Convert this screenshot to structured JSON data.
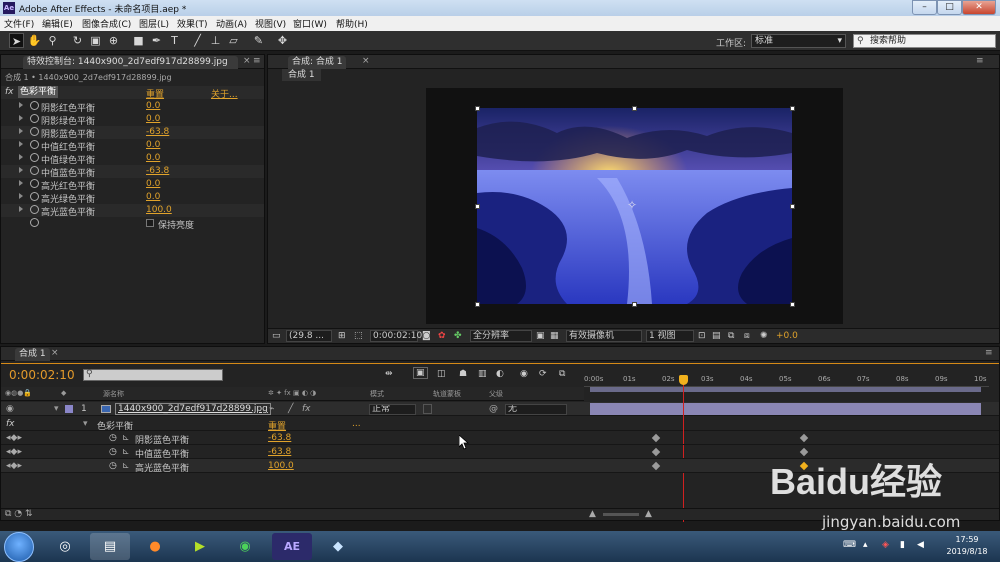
{
  "window": {
    "title": "Adobe After Effects - 未命名项目.aep *",
    "app_icon": "Ae",
    "minimize": "–",
    "maximize": "□",
    "close": "✕"
  },
  "menu": [
    "文件(F)",
    "编辑(E)",
    "图像合成(C)",
    "图层(L)",
    "效果(T)",
    "动画(A)",
    "视图(V)",
    "窗口(W)",
    "帮助(H)"
  ],
  "toolbar": {
    "workspace_label": "工作区:",
    "workspace_value": "标准",
    "help_placeholder": "搜索帮助"
  },
  "effect_controls": {
    "tab": "特效控制台: 1440x900_2d7edf917d28899.jpg",
    "breadcrumb": "合成 1 • 1440x900_2d7edf917d28899.jpg",
    "effect_name": "色彩平衡",
    "reset": "重置",
    "about": "关于...",
    "fx_label": "fx",
    "properties": [
      {
        "name": "阴影红色平衡",
        "value": "0.0"
      },
      {
        "name": "阴影绿色平衡",
        "value": "0.0"
      },
      {
        "name": "阴影蓝色平衡",
        "value": "-63.8"
      },
      {
        "name": "中值红色平衡",
        "value": "0.0"
      },
      {
        "name": "中值绿色平衡",
        "value": "0.0"
      },
      {
        "name": "中值蓝色平衡",
        "value": "-63.8"
      },
      {
        "name": "高光红色平衡",
        "value": "0.0"
      },
      {
        "name": "高光绿色平衡",
        "value": "0.0"
      },
      {
        "name": "高光蓝色平衡",
        "value": "100.0"
      }
    ],
    "preserve_luminosity": "保持亮度"
  },
  "composition": {
    "tab": "合成: 合成 1",
    "subtab": "合成 1",
    "zoom": "(29.8 ...",
    "timecode": "0:00:02:10",
    "resolution": "全分辨率",
    "camera": "有效摄像机",
    "views": "1 视图",
    "exposure": "+0.0"
  },
  "timeline": {
    "tab": "合成 1",
    "timecode": "0:00:02:10",
    "col_source": "源名称",
    "col_mode": "模式",
    "col_trkmat": "轨道蒙板",
    "col_parent": "父级",
    "ruler": [
      "0:00s",
      "01s",
      "02s",
      "03s",
      "04s",
      "05s",
      "06s",
      "07s",
      "08s",
      "09s",
      "10s"
    ],
    "layer": {
      "index": "1",
      "name": "1440x900_2d7edf917d28899.jpg",
      "mode": "正常",
      "parent": "无"
    },
    "effect": {
      "name": "色彩平衡",
      "reset": "重置",
      "dots": "...",
      "fx": "fx"
    },
    "props": [
      {
        "name": "阴影蓝色平衡",
        "value": "-63.8"
      },
      {
        "name": "中值蓝色平衡",
        "value": "-63.8"
      },
      {
        "name": "高光蓝色平衡",
        "value": "100.0"
      }
    ]
  },
  "taskbar": {
    "time": "17:59",
    "date": "2019/8/18",
    "ae_label": "AE"
  },
  "watermark": {
    "brand": "Baidu经验",
    "url": "jingyan.baidu.com"
  }
}
